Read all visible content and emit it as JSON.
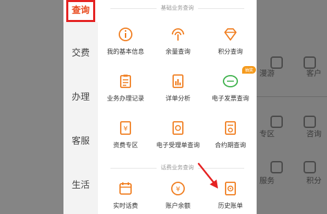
{
  "background": {
    "items": [
      "漫游",
      "客户",
      "专区",
      "咨询",
      "服务",
      "积分"
    ]
  },
  "sidebar": {
    "items": [
      {
        "label": "查询",
        "active": true
      },
      {
        "label": "交费"
      },
      {
        "label": "办理"
      },
      {
        "label": "客服"
      },
      {
        "label": "生活"
      }
    ]
  },
  "sections": [
    {
      "title": "基础业务查询",
      "items": [
        {
          "label": "我的基本信息",
          "icon": "info-icon"
        },
        {
          "label": "余量查询",
          "icon": "signal-icon"
        },
        {
          "label": "积分查询",
          "icon": "diamond-icon"
        },
        {
          "label": "业务办理记录",
          "icon": "clipboard-icon"
        },
        {
          "label": "详单分析",
          "icon": "document-chart-icon"
        },
        {
          "label": "电子发票查询",
          "icon": "invoice-icon",
          "badge": "抽奖"
        },
        {
          "label": "资费专区",
          "icon": "yuan-card-icon"
        },
        {
          "label": "电子受理单查询",
          "icon": "receipt-icon"
        },
        {
          "label": "合约期查询",
          "icon": "contract-icon"
        }
      ]
    },
    {
      "title": "话费业务查询",
      "items": [
        {
          "label": "实时话费",
          "icon": "calendar-icon"
        },
        {
          "label": "账户余额",
          "icon": "yuan-coin-icon"
        },
        {
          "label": "历史账单",
          "icon": "bill-icon"
        }
      ]
    }
  ],
  "colors": {
    "accent": "#f07d1f",
    "active_text": "#e8491d",
    "highlight_box": "#e52222"
  }
}
